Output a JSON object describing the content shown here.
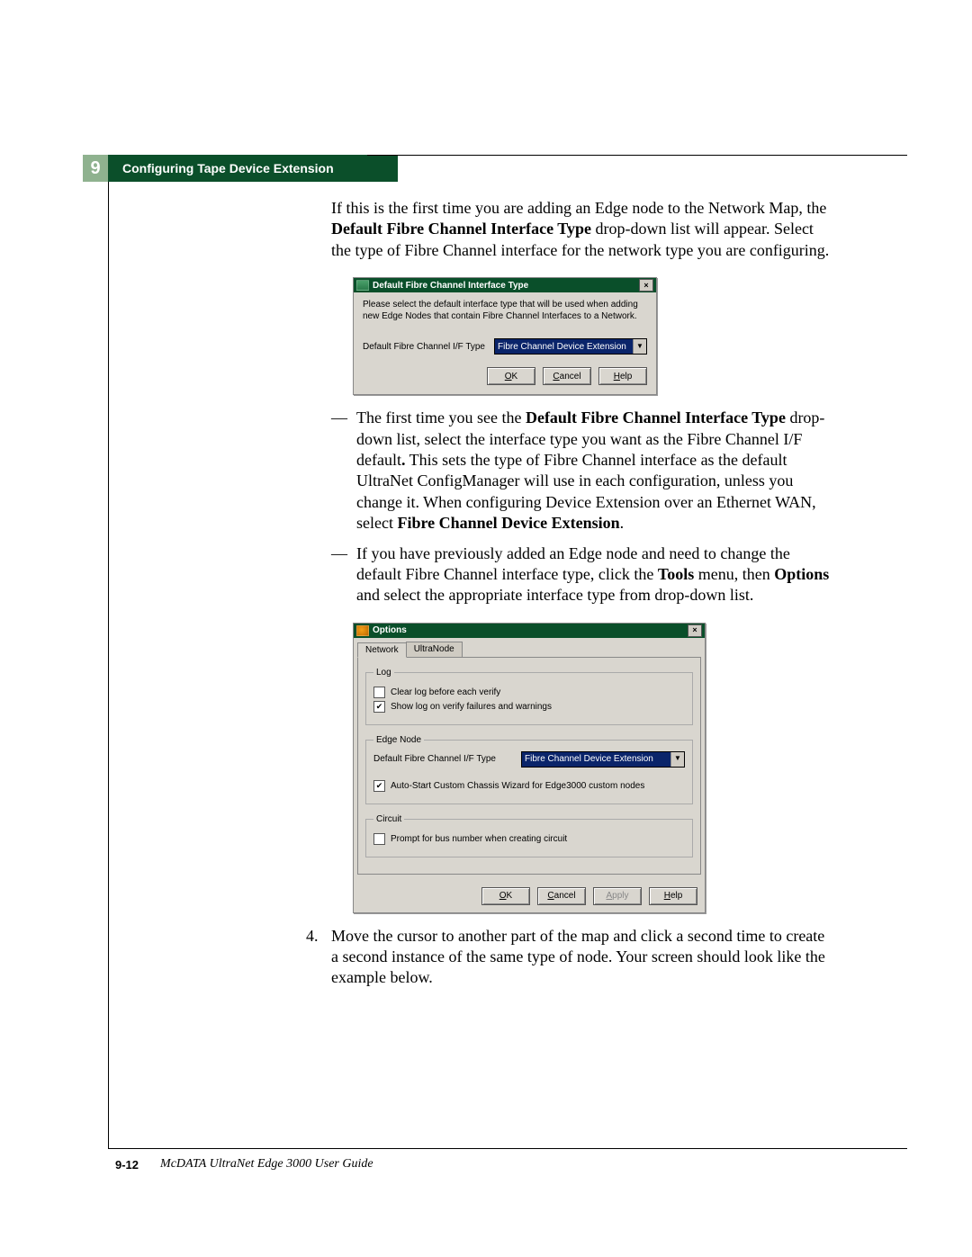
{
  "chapter": {
    "number": "9",
    "title": "Configuring Tape Device Extension"
  },
  "intro": {
    "t1": "If this is the first time you are adding an Edge node to the Network Map, the ",
    "bold1": "Default Fibre Channel Interface Type",
    "t2": " drop-down list will appear. Select the type of Fibre Channel interface for the network type you are configuring."
  },
  "dlg1": {
    "title": "Default Fibre Channel Interface Type",
    "msg": "Please select the default interface type that will be used when adding new Edge Nodes that contain Fibre Channel Interfaces to a Network.",
    "label": "Default Fibre Channel I/F Type",
    "selected": "Fibre Channel Device Extension",
    "ok_u": "O",
    "ok_r": "K",
    "cancel_u": "C",
    "cancel_r": "ancel",
    "help_u": "H",
    "help_r": "elp"
  },
  "bul1": {
    "dash": "—",
    "a1": "The first time you see the ",
    "b1": "Default Fibre Channel Interface Type",
    "a2": " drop-down list, select the interface type you want as the Fibre Channel I/F default",
    "b2": ".",
    "a3": " This sets the type of Fibre Channel interface as the default UltraNet ConfigManager will use in each configuration, unless you change it. When configuring Device Extension over an Ethernet WAN, select ",
    "b3": "Fibre Channel Device Extension",
    "a4": "."
  },
  "bul2": {
    "dash": "—",
    "a1": "If you have previously added an Edge node and need to change the default Fibre Channel interface type, click the ",
    "b1": "Tools",
    "a2": " menu, then ",
    "b2": "Options",
    "a3": " and select the appropriate interface type from drop-down list."
  },
  "dlg2": {
    "title": "Options",
    "tab_active": "Network",
    "tab_inactive": "UltraNode",
    "grp_log": "Log",
    "chk_clear": "Clear log before each verify",
    "chk_show": "Show log on verify failures and warnings",
    "grp_edge": "Edge Node",
    "label_if": "Default Fibre Channel I/F Type",
    "sel_if": "Fibre Channel Device Extension",
    "chk_auto": "Auto-Start Custom Chassis Wizard for Edge3000 custom nodes",
    "grp_circ": "Circuit",
    "chk_prompt": "Prompt for bus number when creating circuit",
    "ok_u": "O",
    "ok_r": "K",
    "cancel_u": "C",
    "cancel_r": "ancel",
    "apply_u": "A",
    "apply_r": "pply",
    "help_u": "H",
    "help_r": "elp"
  },
  "step4": {
    "num": "4.",
    "text": "Move the cursor to another part of the map and click a second time to create a second instance of the same type of node. Your screen should look like the example below."
  },
  "footer": {
    "page": "9-12",
    "guide": "McDATA UltraNet Edge 3000 User Guide"
  }
}
